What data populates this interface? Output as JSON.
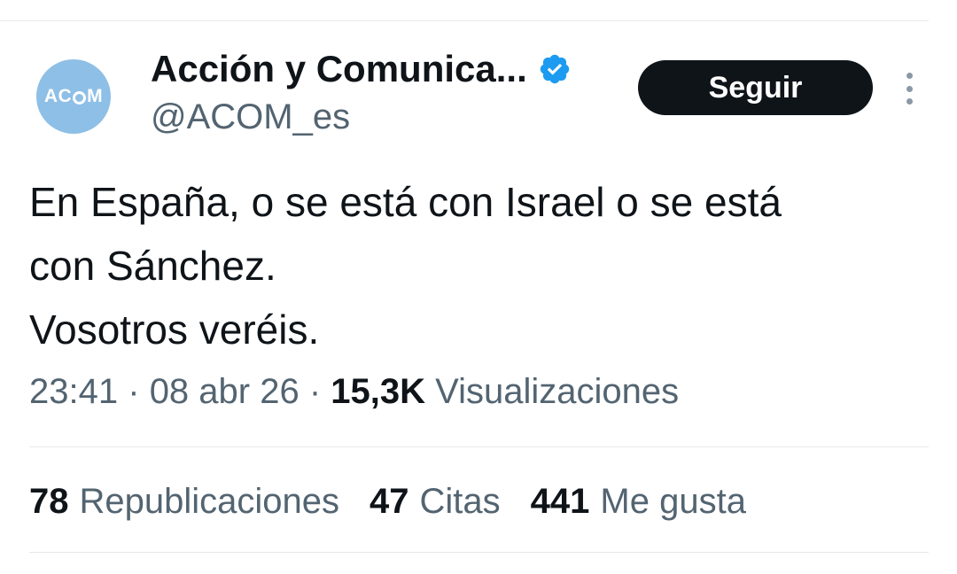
{
  "account": {
    "avatar_text_a": "AC",
    "avatar_text_b": "M",
    "display_name": "Acción y Comunica...",
    "handle": "@ACOM_es",
    "verified_icon": "verified-badge-icon",
    "verified_color": "#1d9bf0"
  },
  "actions": {
    "follow_label": "Seguir",
    "more_icon": "more-vertical-icon"
  },
  "tweet": {
    "lines": [
      "En España, o se está con Israel o se está",
      "con Sánchez.",
      "Vosotros veréis."
    ],
    "time": "23:41",
    "separator": "·",
    "date": "08 abr 26",
    "views_count": "15,3K",
    "views_label": "Visualizaciones"
  },
  "stats": {
    "reposts_count": "78",
    "reposts_label": "Republicaciones",
    "quotes_count": "47",
    "quotes_label": "Citas",
    "likes_count": "441",
    "likes_label": "Me gusta"
  },
  "colors": {
    "text_primary": "#0f1419",
    "text_secondary": "#536471",
    "avatar_bg": "#8ebfe6",
    "button_bg": "#0f1419"
  }
}
